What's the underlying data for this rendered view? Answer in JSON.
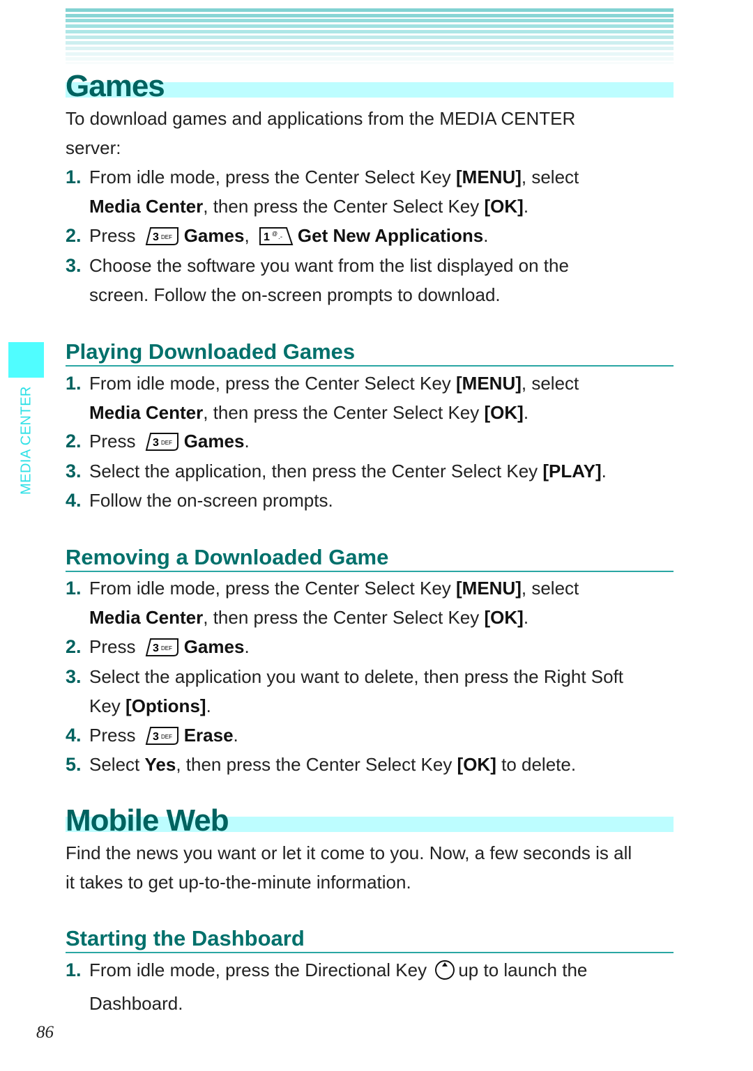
{
  "sidebar": {
    "section_label": "MEDIA CENTER"
  },
  "games": {
    "title": "Games",
    "intro": "To download games and applications from the MEDIA CENTER server:",
    "steps": [
      {
        "num": "1.",
        "pre": "From idle mode, press the Center Select Key ",
        "b1": "[MENU]",
        "mid": ", select ",
        "b2": "Media Center",
        "mid2": ", then press the Center Select Key ",
        "b3": "[OK]",
        "post": "."
      },
      {
        "num": "2.",
        "pre": "Press",
        "key1": "3 DEF",
        "b1": "Games",
        "sep": ",",
        "key2": "1",
        "b2": "Get New Applications",
        "post": "."
      },
      {
        "num": "3.",
        "line1": "Choose the software you want from the list displayed on the",
        "line2": "screen. Follow the on-screen prompts to download."
      }
    ]
  },
  "playing": {
    "title": "Playing Downloaded Games",
    "steps": [
      {
        "num": "1.",
        "pre": "From idle mode, press the Center Select Key ",
        "b1": "[MENU]",
        "mid": ", select ",
        "b2": "Media Center",
        "mid2": ", then press the Center Select Key ",
        "b3": "[OK]",
        "post": "."
      },
      {
        "num": "2.",
        "pre": "Press",
        "key1": "3 DEF",
        "b1": "Games",
        "post": "."
      },
      {
        "num": "3.",
        "pre": "Select the application, then press the Center Select Key ",
        "b1": "[PLAY]",
        "post": "."
      },
      {
        "num": "4.",
        "pre": "Follow the on-screen prompts."
      }
    ]
  },
  "removing": {
    "title": "Removing a Downloaded Game",
    "steps": [
      {
        "num": "1.",
        "pre": "From idle mode, press the Center Select Key ",
        "b1": "[MENU]",
        "mid": ", select ",
        "b2": "Media Center",
        "mid2": ", then press the Center Select Key ",
        "b3": "[OK]",
        "post": "."
      },
      {
        "num": "2.",
        "pre": "Press",
        "key1": "3 DEF",
        "b1": "Games",
        "post": "."
      },
      {
        "num": "3.",
        "line1": "Select the application you want to delete, then press the Right Soft",
        "pre2": "Key ",
        "b1": "[Options]",
        "post": "."
      },
      {
        "num": "4.",
        "pre": "Press",
        "key1": "3 DEF",
        "b1": "Erase",
        "post": "."
      },
      {
        "num": "5.",
        "pre": "Select ",
        "b1": "Yes",
        "mid": ", then press the Center Select Key ",
        "b2": "[OK]",
        "post": " to delete."
      }
    ]
  },
  "mobile_web": {
    "title": "Mobile Web",
    "intro_line1": "Find the news you want or let it come to you. Now, a few seconds is all",
    "intro_line2": "it takes to get up-to-the-minute information."
  },
  "dashboard": {
    "title": "Starting the Dashboard",
    "steps": [
      {
        "num": "1.",
        "pre": "From idle mode, press the Directional Key",
        "post": "up to launch the",
        "line2": "Dashboard."
      }
    ]
  },
  "footer": {
    "page_number": "86"
  },
  "colors": {
    "heading": "#00625f",
    "band": "#bdfdff",
    "accent": "#50fdff"
  }
}
